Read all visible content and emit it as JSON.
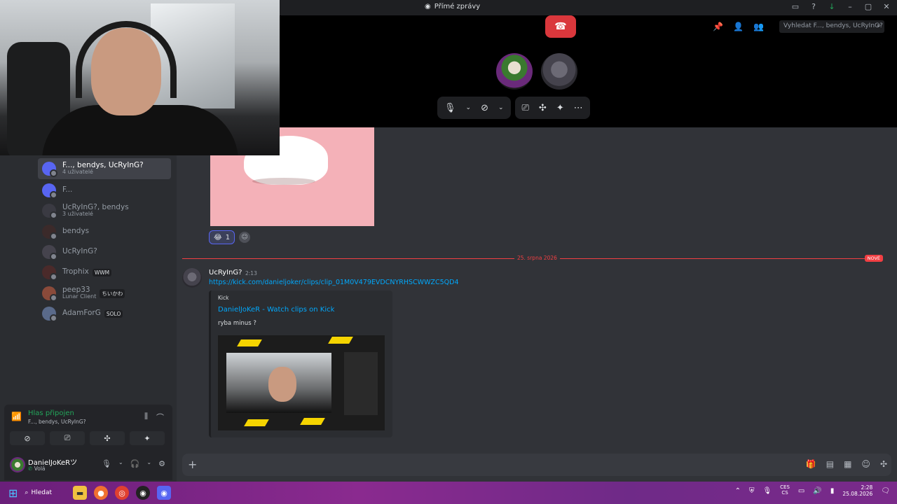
{
  "window": {
    "title": "Přímé zprávy",
    "title_icon": "discord-icon",
    "icons": [
      "inbox-icon",
      "help-icon",
      "download-icon",
      "minimize-icon",
      "maximize-icon",
      "close-icon"
    ]
  },
  "call": {
    "top_icons": [
      "pin-icon",
      "add-friend-icon",
      "members-icon"
    ],
    "search_placeholder": "Vyhledat F..., bendys, UcRyInG?",
    "controls": [
      "mic-icon",
      "chevron-down-icon",
      "camera-off-icon",
      "chevron-down-icon",
      "screen-share-icon",
      "activity-icon",
      "soundboard-icon",
      "more-icon"
    ],
    "hangup_icon": "phone-hangup-icon"
  },
  "sidebar": {
    "dms": [
      {
        "name": "F..., bendys, UcRyInG?",
        "sub": "4 uživatelé",
        "active": true,
        "color": "#5865f2"
      },
      {
        "name": "F...",
        "sub": "",
        "active": false,
        "color": "#5865f2"
      },
      {
        "name": "UcRyInG?, bendys",
        "sub": "3 uživatelé",
        "active": false,
        "color": "#3a3a42"
      },
      {
        "name": "bendys",
        "sub": "",
        "active": false,
        "color": "#3b2a2a"
      },
      {
        "name": "UcRyInG?",
        "sub": "",
        "active": false,
        "color": "#45434d"
      },
      {
        "name": "Trophix",
        "sub": "",
        "tag": "WWM",
        "active": false,
        "color": "#4a2a2a"
      },
      {
        "name": "peep33",
        "sub": "Lunar Client",
        "tag": "ちいかわ",
        "active": false,
        "color": "#8a4a3a"
      },
      {
        "name": "AdamForG",
        "sub": "",
        "tag": "SOLO",
        "active": false,
        "color": "#5a6a8a"
      }
    ]
  },
  "voice": {
    "status": "Hlas připojen",
    "channel": "F..., bendys, UcRyInG?",
    "buttons": [
      "camera-off-icon",
      "screen-share-icon",
      "activity-icon",
      "soundboard-icon"
    ]
  },
  "user": {
    "name": "DanielJoKeRツ",
    "status": "Volá"
  },
  "chat": {
    "reaction_count": "1",
    "divider_date": "25. srpna 2026",
    "new_label": "NOVÉ",
    "message": {
      "author": "UcRyInG?",
      "time": "2:13",
      "link": "https://kick.com/danieljoker/clips/clip_01M0V479EVDCNYRHSCWWZC5QD4"
    },
    "embed": {
      "provider": "Kick",
      "title": "DanielJoKeR - Watch clips on Kick",
      "description": "ryba minus ?"
    },
    "composer_icons": [
      "gift-icon",
      "gif-icon",
      "sticker-icon",
      "emoji-icon",
      "apps-icon"
    ]
  },
  "taskbar": {
    "search_label": "Hledat",
    "lang_top": "CES",
    "lang_bottom": "CS",
    "time": "2:28",
    "date": "25.08.2026",
    "accent": "#4cc2ff"
  }
}
